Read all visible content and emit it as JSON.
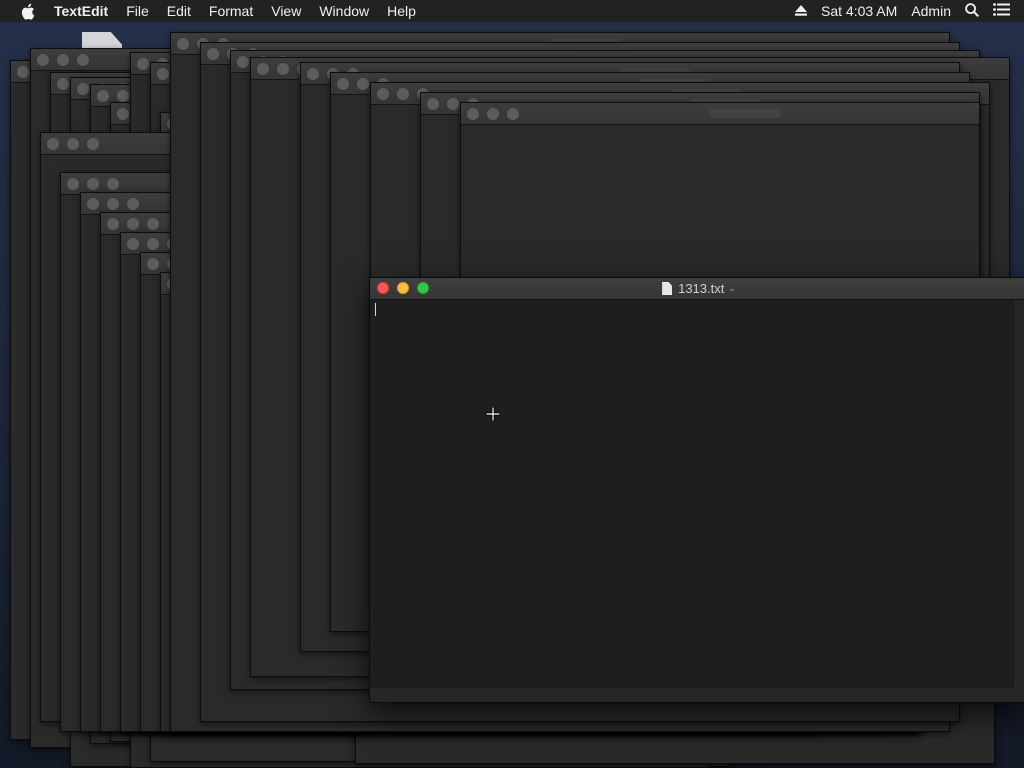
{
  "menubar": {
    "apple_icon": "apple-icon",
    "app_name": "TextEdit",
    "items": [
      "File",
      "Edit",
      "Format",
      "View",
      "Window",
      "Help"
    ],
    "eject_icon": "eject-icon",
    "clock": "Sat 4:03 AM",
    "user": "Admin",
    "search_icon": "spotlight-search-icon",
    "notifications_icon": "notification-center-icon"
  },
  "front_window": {
    "title": "1313.txt",
    "document_icon": "document-icon",
    "title_chevron": "⌄",
    "traffic_lights": {
      "close": "#fc5753",
      "minimize": "#fdbc40",
      "zoom": "#33c748"
    }
  }
}
